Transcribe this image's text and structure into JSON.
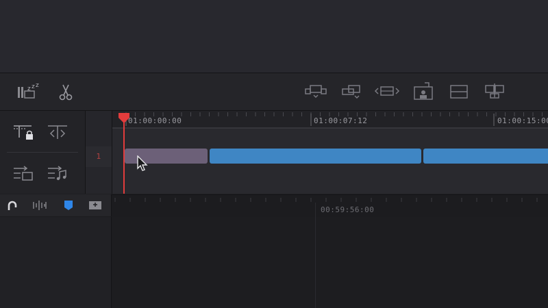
{
  "timeline": {
    "ruler_labels": [
      "01:00:00:00",
      "01:00:07:12",
      "01:00:15:00"
    ],
    "track_number": "1",
    "lower_ruler_label": "00:59:56:00"
  },
  "colors": {
    "playhead": "#e23c3c",
    "clip_selected": "#6c6078",
    "clip_video": "#3f86c4",
    "accent_marker": "#2f86e8"
  },
  "icons": {
    "toolbar_left": [
      "sleep-mode-icon",
      "blade-scissors-icon"
    ],
    "toolbar_right": [
      "insert-clip-icon",
      "overwrite-clip-icon",
      "replace-clip-icon",
      "place-on-top-icon",
      "append-end-icon",
      "ripple-overwrite-icon"
    ],
    "track_controls": [
      "lock-track-icon",
      "trim-track-icon",
      "audio-video-insert-icon",
      "audio-only-icon"
    ],
    "mid_controls": [
      "snap-magnet-icon",
      "audio-waveform-icon",
      "marker-flag-icon",
      "add-track-icon"
    ]
  }
}
